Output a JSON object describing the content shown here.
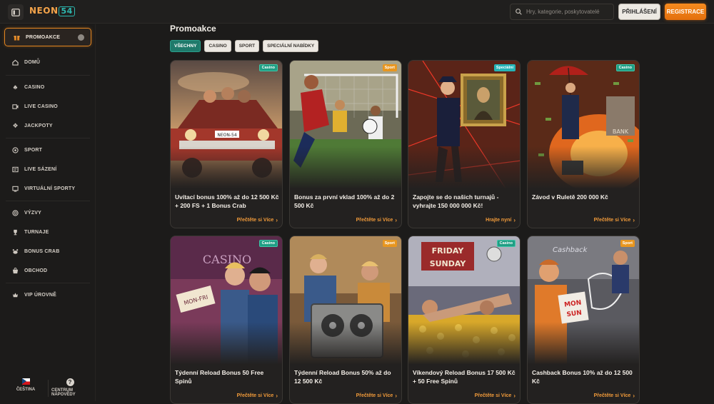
{
  "header": {
    "logo_main": "NEON",
    "logo_num": "54",
    "search_placeholder": "Hry, kategorie, poskytovatelé",
    "login_label": "PŘIHLÁŠENÍ",
    "register_label": "REGISTRACE"
  },
  "sidebar": {
    "promo_label": "PROMOAKCE",
    "items": [
      {
        "label": "DOMŮ",
        "icon": "home-icon"
      },
      {
        "label": "CASINO",
        "icon": "clubs-icon"
      },
      {
        "label": "LIVE CASINO",
        "icon": "live-casino-icon"
      },
      {
        "label": "JACKPOTY",
        "icon": "jackpot-icon"
      },
      {
        "label": "SPORT",
        "icon": "soccer-ball-icon"
      },
      {
        "label": "LIVE SÁZENÍ",
        "icon": "live-bet-icon"
      },
      {
        "label": "VIRTUÁLNÍ SPORTY",
        "icon": "virtual-sports-icon"
      },
      {
        "label": "VÝZVY",
        "icon": "challenge-icon"
      },
      {
        "label": "TURNAJE",
        "icon": "trophy-icon"
      },
      {
        "label": "BONUS CRAB",
        "icon": "crab-icon"
      },
      {
        "label": "OBCHOD",
        "icon": "shop-icon"
      },
      {
        "label": "VIP ÚROVNĚ",
        "icon": "vip-icon"
      }
    ],
    "language_label": "ČEŠTINA",
    "help_label": "CENTRUM NÁPOVĚDY"
  },
  "main": {
    "title": "Promoakce",
    "filters": [
      "VŠECHNY",
      "CASINO",
      "SPORT",
      "SPECIÁLNÍ NABÍDKY"
    ],
    "cards": [
      {
        "tag": "Casino",
        "title": "Uvítací bonus 100% až do 12 500 Kč + 200 FS + 1 Bonus Crab",
        "link": "Přečtěte si Více"
      },
      {
        "tag": "Sport",
        "title": "Bonus za první vklad 100% až do 2 500 Kč",
        "link": "Přečtěte si Více"
      },
      {
        "tag": "Speciální",
        "title": "Zapojte se do našich turnajů - vyhrajte 150 000 000 Kč!",
        "link": "Hrajte nyní"
      },
      {
        "tag": "Casino",
        "title": "Závod v Ruletě 200 000 Kč",
        "link": "Přečtěte si Více"
      },
      {
        "tag": "Casino",
        "title": "Týdenní Reload Bonus 50 Free Spinů",
        "link": "Přečtěte si Více"
      },
      {
        "tag": "Sport",
        "title": "Týdenní Reload Bonus 50% až do 12 500 Kč",
        "link": "Přečtěte si Více"
      },
      {
        "tag": "Casino",
        "title": "Víkendový Reload Bonus 17 500 Kč + 50 Free Spinů",
        "link": "Přečtěte si Více"
      },
      {
        "tag": "Sport",
        "title": "Cashback Bonus 10% až do 12 500 Kč",
        "link": "Přečtěte si Více"
      }
    ],
    "art_text": {
      "plate": "NEON-54",
      "casino_sign": "CASINO",
      "ticket": "MON-FRI",
      "friday": "FRIDAY",
      "sunday": "SUNDAY",
      "cashback": "Cashback",
      "mon": "MON",
      "sun": "SUN",
      "bank": "BANK"
    }
  },
  "colors": {
    "accent": "#e38520",
    "teal": "#1f7a6b",
    "background": "#1c1b1a"
  }
}
